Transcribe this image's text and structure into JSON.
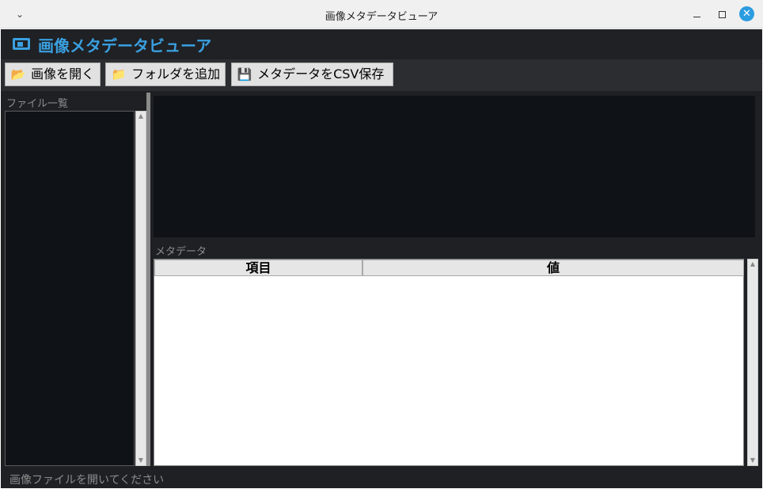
{
  "window": {
    "title": "画像メタデータビューア"
  },
  "header": {
    "icon": "image-frame-icon",
    "title": "画像メタデータビューア",
    "accent": "#3aa0e0"
  },
  "toolbar": {
    "open_image": {
      "icon": "📂",
      "label": "画像を開く"
    },
    "add_folder": {
      "icon": "📁",
      "label": "フォルダを追加"
    },
    "save_csv": {
      "icon": "💾",
      "label": "メタデータをCSV保存"
    }
  },
  "file_list": {
    "label": "ファイル一覧",
    "items": []
  },
  "metadata": {
    "label": "メタデータ",
    "columns": [
      "項目",
      "値"
    ],
    "rows": []
  },
  "status": {
    "text": "画像ファイルを開いてください"
  }
}
